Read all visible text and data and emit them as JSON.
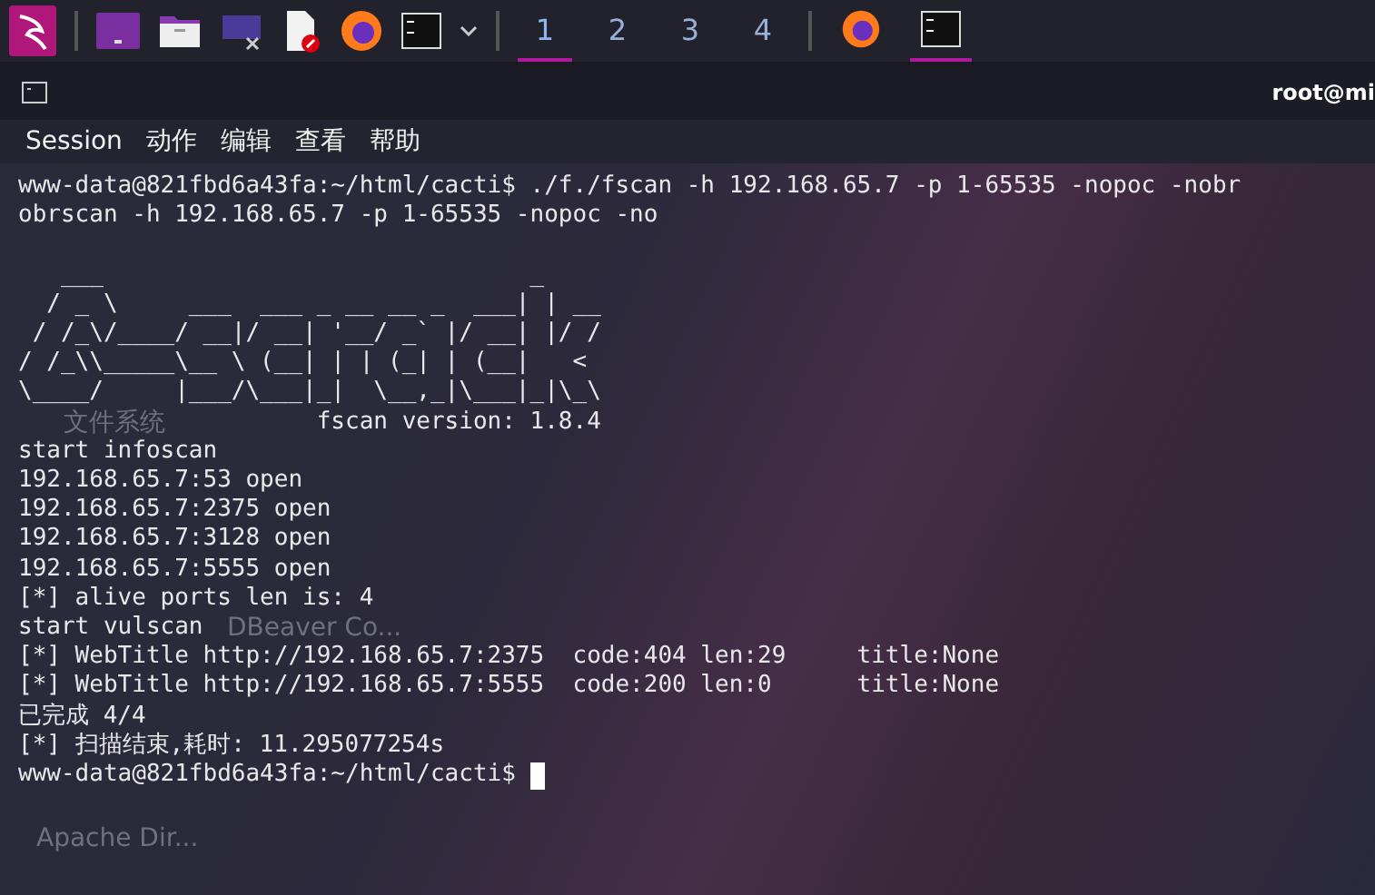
{
  "taskbar": {
    "workspaces": [
      {
        "label": "1",
        "selected": true
      },
      {
        "label": "2",
        "selected": false
      },
      {
        "label": "3",
        "selected": false
      },
      {
        "label": "4",
        "selected": false
      }
    ],
    "tasks": [
      {
        "kind": "browser",
        "selected": false
      },
      {
        "kind": "terminal",
        "selected": true
      }
    ]
  },
  "desktop_icons": [
    {
      "label": "文件系统"
    },
    {
      "label": "DBeaver Co..."
    },
    {
      "label": "Apache Dir..."
    }
  ],
  "terminal": {
    "title": "root@mi",
    "menu": [
      "Session",
      "动作",
      "编辑",
      "查看",
      "帮助"
    ],
    "command_lines": [
      "www-data@821fbd6a43fa:~/html/cacti$ ./f./fscan -h 192.168.65.7 -p 1-65535 -nopoc -nobr",
      "obrscan -h 192.168.65.7 -p 1-65535 -nopoc -no"
    ],
    "banner": [
      "   ___                              _    ",
      "  / _ \\     ___  ___ _ __ __ _  ___| | __ ",
      " / /_\\/____/ __|/ __| '__/ _` |/ __| |/ /",
      "/ /_\\\\_____\\__ \\ (__| | | (_| | (__|   <    ",
      "\\____/     |___/\\___|_|  \\__,_|\\___|_|\\_\\   "
    ],
    "version": "fscan version: 1.8.4",
    "output_lines": [
      "start infoscan",
      "192.168.65.7:53 open",
      "192.168.65.7:2375 open",
      "192.168.65.7:3128 open",
      "192.168.65.7:5555 open",
      "[*] alive ports len is: 4",
      "start vulscan",
      "[*] WebTitle http://192.168.65.7:2375  code:404 len:29     title:None",
      "[*] WebTitle http://192.168.65.7:5555  code:200 len:0      title:None",
      "已完成 4/4",
      "[*] 扫描结束,耗时: 11.295077254s"
    ],
    "prompt": "www-data@821fbd6a43fa:~/html/cacti$"
  }
}
